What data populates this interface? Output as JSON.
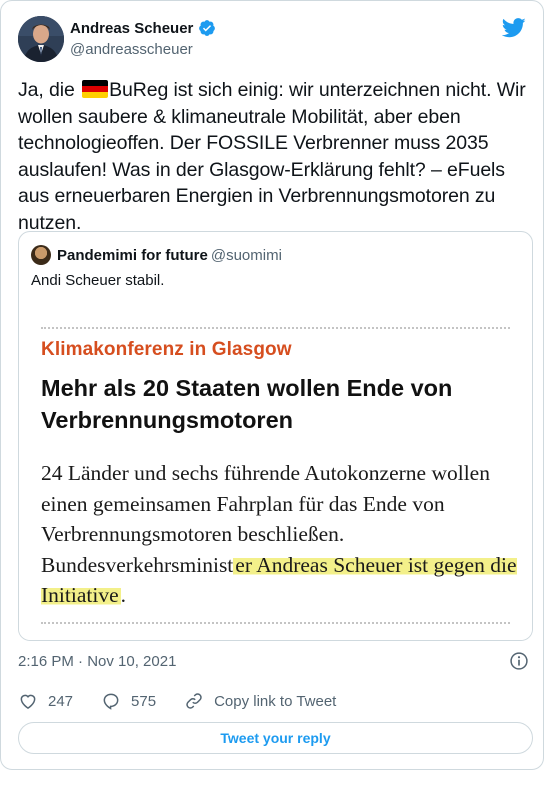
{
  "author": {
    "name": "Andreas Scheuer",
    "handle": "@andreasscheuer"
  },
  "tweet": {
    "text_before_flag": "Ja, die ",
    "text_after_flag": "BuReg ist sich einig: wir unterzeichnen nicht. Wir wollen saubere & klimaneutrale Mobilität, aber eben technologieoffen. Der FOSSILE Verbrenner muss 2035 auslaufen! Was in der Glasgow-Erklärung fehlt? – eFuels aus erneuerbaren Energien in Verbrennungsmotoren zu nutzen."
  },
  "quote": {
    "name": "Pandemimi for future",
    "handle": "@suomimi",
    "text": "Andi Scheuer stabil.",
    "media": {
      "kicker": "Klimakonferenz in Glasgow",
      "headline": "Mehr als 20 Staaten wollen Ende von Verbrennungsmotoren",
      "body_plain": "24 Länder und sechs führende Autokonzerne wollen einen gemeinsamen Fahrplan für das Ende von Verbrennungsmotoren beschließen. Bundesverkehrsminist",
      "body_highlighted": "er Andreas Scheuer ist gegen die Initiative",
      "body_end": "."
    }
  },
  "meta": {
    "timestamp": "2:16 PM · Nov 10, 2021"
  },
  "actions": {
    "likes": "247",
    "replies": "575",
    "copy_link": "Copy link to Tweet"
  },
  "reply_button": "Tweet your reply",
  "colors": {
    "accent": "#1d9bf0",
    "text": "#0f1419",
    "muted": "#536471",
    "kicker": "#d64e1f",
    "highlight": "#f3f08a"
  },
  "icons": [
    "verified-badge-icon",
    "twitter-bird-icon",
    "info-icon",
    "heart-icon",
    "reply-icon",
    "link-icon",
    "german-flag-emoji"
  ]
}
